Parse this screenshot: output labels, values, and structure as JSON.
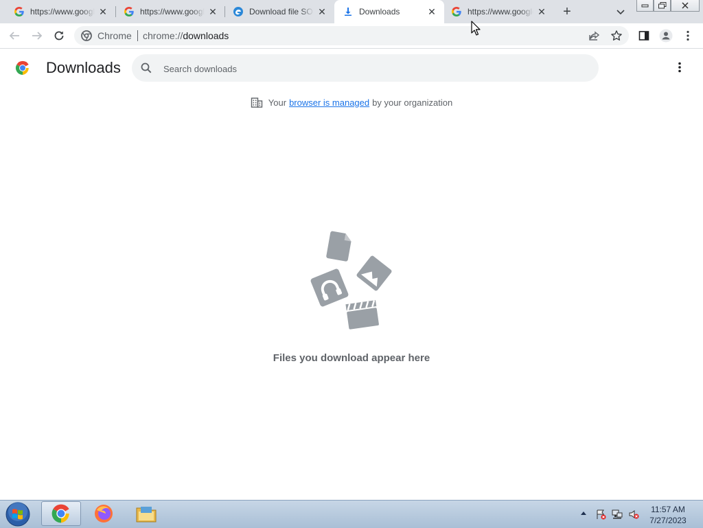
{
  "tabs": [
    {
      "title": "https://www.google.com/search",
      "favicon": "google-g-icon",
      "active": false
    },
    {
      "title": "https://www.google.com/search",
      "favicon": "google-g-icon",
      "active": false
    },
    {
      "title": "Download file SOURCES",
      "favicon": "edge-icon",
      "active": false
    },
    {
      "title": "Downloads",
      "favicon": "download-icon",
      "active": true
    },
    {
      "title": "https://www.google.com/search",
      "favicon": "google-g-icon",
      "active": false
    }
  ],
  "toolbar": {
    "chip_label": "Chrome",
    "url_scheme": "chrome://",
    "url_host": "downloads"
  },
  "page": {
    "title": "Downloads",
    "search_placeholder": "Search downloads",
    "managed_prefix": "Your",
    "managed_link": "browser is managed",
    "managed_suffix": "by your organization",
    "empty_message": "Files you download appear here"
  },
  "taskbar": {
    "apps": [
      "chrome-icon",
      "firefox-icon",
      "file-explorer-icon"
    ],
    "active_app": "chrome-icon"
  },
  "clock": {
    "time": "11:57 AM",
    "date": "7/27/2023"
  },
  "colors": {
    "accent": "#1a73e8",
    "tabstrip": "#dee1e6",
    "illustration": "#9aa0a6"
  }
}
